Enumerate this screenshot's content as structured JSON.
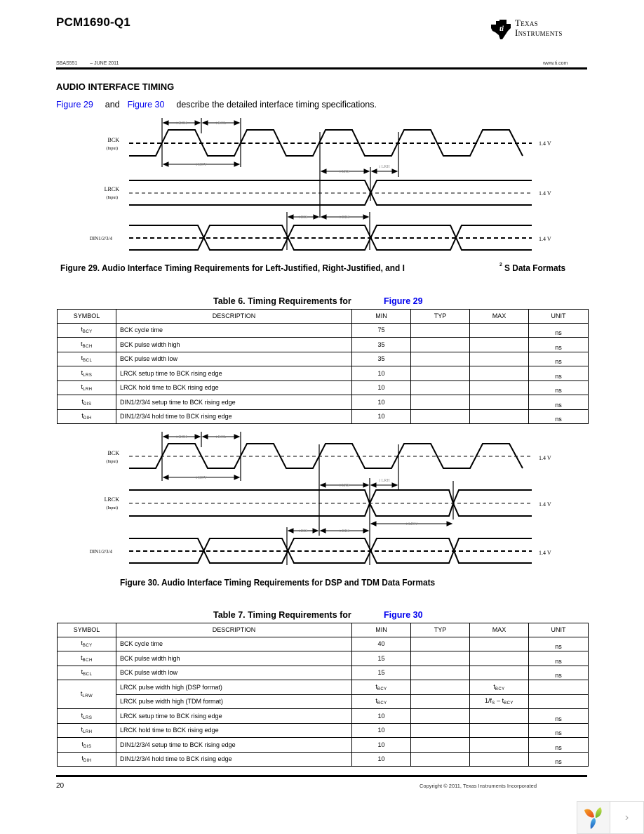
{
  "header": {
    "doc_title": "PCM1690-Q1",
    "brand_line1": "Texas",
    "brand_line2": "Instruments",
    "doc_id": "SBAS551",
    "date": "– JUNE 2011",
    "website": "www.ti.com"
  },
  "section": {
    "title": "AUDIO INTERFACE TIMING",
    "intro_link1": "Figure 29",
    "intro_and": "and",
    "intro_link2": "Figure 30",
    "intro_text": "describe the detailed interface timing specifications."
  },
  "figure29": {
    "signals": [
      {
        "name": "BCK",
        "sub": "(Input)",
        "threshold": "1.4 V"
      },
      {
        "name": "LRCK",
        "sub": "(Input)",
        "threshold": "1.4 V"
      },
      {
        "name": "DIN1/2/3/4",
        "sub": "",
        "threshold": "1.4 V"
      }
    ],
    "timing_labels": [
      "tBCH",
      "tBCL",
      "tBCY",
      "tLRS",
      "tLRH",
      "tDIS",
      "tDIH"
    ],
    "caption_part1": "Figure 29. Audio Interface Timing Requirements for Left-Justified, Right-Justified, and I",
    "caption_sup": "2",
    "caption_part2": "S Data Formats"
  },
  "table6": {
    "caption": "Table 6. Timing Requirements for",
    "caption_link": "Figure 29",
    "columns": [
      "SYMBOL",
      "DESCRIPTION",
      "MIN",
      "TYP",
      "MAX",
      "UNIT"
    ],
    "rows": [
      {
        "sym": "t",
        "sub": "BCY",
        "desc": "BCK cycle time",
        "min": "75",
        "typ": "",
        "max": "",
        "unit": "ns"
      },
      {
        "sym": "t",
        "sub": "BCH",
        "desc": "BCK pulse width high",
        "min": "35",
        "typ": "",
        "max": "",
        "unit": "ns"
      },
      {
        "sym": "t",
        "sub": "BCL",
        "desc": "BCK pulse width low",
        "min": "35",
        "typ": "",
        "max": "",
        "unit": "ns"
      },
      {
        "sym": "t",
        "sub": "LRS",
        "desc": "LRCK setup time to BCK rising edge",
        "min": "10",
        "typ": "",
        "max": "",
        "unit": "ns"
      },
      {
        "sym": "t",
        "sub": "LRH",
        "desc": "LRCK hold time to BCK rising edge",
        "min": "10",
        "typ": "",
        "max": "",
        "unit": "ns"
      },
      {
        "sym": "t",
        "sub": "DIS",
        "desc": "DIN1/2/3/4 setup time to BCK rising edge",
        "min": "10",
        "typ": "",
        "max": "",
        "unit": "ns"
      },
      {
        "sym": "t",
        "sub": "DIH",
        "desc": "DIN1/2/3/4 hold time to BCK rising edge",
        "min": "10",
        "typ": "",
        "max": "",
        "unit": "ns"
      }
    ]
  },
  "figure30": {
    "signals": [
      {
        "name": "BCK",
        "sub": "(Input)",
        "threshold": "1.4 V"
      },
      {
        "name": "LRCK",
        "sub": "(Input)",
        "threshold": "1.4 V"
      },
      {
        "name": "DIN1/2/3/4",
        "sub": "",
        "threshold": "1.4 V"
      }
    ],
    "timing_labels": [
      "tBCH",
      "tBCL",
      "tBCY",
      "tLRS",
      "tLRH",
      "tLRW",
      "tDIS",
      "tDIH"
    ],
    "caption": "Figure 30. Audio Interface Timing Requirements for DSP and TDM Data Formats"
  },
  "table7": {
    "caption": "Table 7. Timing Requirements for",
    "caption_link": "Figure 30",
    "columns": [
      "SYMBOL",
      "DESCRIPTION",
      "MIN",
      "TYP",
      "MAX",
      "UNIT"
    ],
    "rows": [
      {
        "sym": "t",
        "sub": "BCY",
        "desc": "BCK cycle time",
        "min": "40",
        "max": "",
        "unit": "ns"
      },
      {
        "sym": "t",
        "sub": "BCH",
        "desc": "BCK pulse width high",
        "min": "15",
        "max": "",
        "unit": "ns"
      },
      {
        "sym": "t",
        "sub": "BCL",
        "desc": "BCK pulse width low",
        "min": "15",
        "max": "",
        "unit": "ns"
      },
      {
        "sym": "t",
        "sub": "LRW",
        "desc": "LRCK pulse width high (DSP format)",
        "min": "tBCY",
        "max": "tBCY",
        "unit": ""
      },
      {
        "sym": "",
        "sub": "",
        "desc": "LRCK pulse width high (TDM format)",
        "min": "tBCY",
        "max": "1/fS – tBCY",
        "unit": ""
      },
      {
        "sym": "t",
        "sub": "LRS",
        "desc": "LRCK setup time to BCK rising edge",
        "min": "10",
        "max": "",
        "unit": "ns"
      },
      {
        "sym": "t",
        "sub": "LRH",
        "desc": "LRCK hold time to BCK rising edge",
        "min": "10",
        "max": "",
        "unit": "ns"
      },
      {
        "sym": "t",
        "sub": "DIS",
        "desc": "DIN1/2/3/4 setup time to BCK rising edge",
        "min": "10",
        "max": "",
        "unit": "ns"
      },
      {
        "sym": "t",
        "sub": "DIH",
        "desc": "DIN1/2/3/4 hold time to BCK rising edge",
        "min": "10",
        "max": "",
        "unit": "ns"
      }
    ]
  },
  "footer": {
    "page_number": "20",
    "copyright": "Copyright © 2011, Texas Instruments Incorporated"
  },
  "viewer": {
    "next_glyph": "›"
  }
}
